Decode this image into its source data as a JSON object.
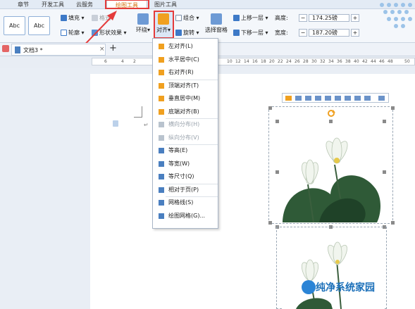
{
  "tabs": [
    "章节",
    "开发工具",
    "云服务",
    "绘图工具",
    "图片工具"
  ],
  "ribbon": {
    "style_samples": [
      "Abc",
      "Abc"
    ],
    "fill": "填充",
    "effect": "格式",
    "outline": "轮廓",
    "shape_effect": "形状效果",
    "wrap": "环绕",
    "align": "对齐",
    "group": "组合",
    "rotate": "旋转",
    "selection_pane": "选择窗格",
    "bring_forward": "上移一层",
    "send_backward": "下移一层",
    "height_label": "高度:",
    "height_value": "174.25磅",
    "width_label": "宽度:",
    "width_value": "187.20磅",
    "minus": "−",
    "plus": "+"
  },
  "doc": {
    "tab_label": "文档3 *",
    "new_tab": "+",
    "close": "×"
  },
  "ruler": {
    "left_ticks": [
      "6",
      "4",
      "2"
    ],
    "right_ticks": [
      "10",
      "12",
      "14",
      "16",
      "18",
      "20",
      "22",
      "24",
      "26",
      "28",
      "30",
      "32",
      "34",
      "36",
      "38",
      "40",
      "42",
      "44",
      "46",
      "48"
    ],
    "end_tick": "50"
  },
  "menu": {
    "items": [
      {
        "label": "左对齐(L)",
        "disabled": false,
        "color": "#f0a020"
      },
      {
        "label": "水平居中(C)",
        "disabled": false,
        "color": "#f0a020"
      },
      {
        "label": "右对齐(R)",
        "disabled": false,
        "color": "#f0a020"
      },
      {
        "label": "顶端对齐(T)",
        "disabled": false,
        "color": "#f0a020"
      },
      {
        "label": "垂直居中(M)",
        "disabled": false,
        "color": "#f0a020"
      },
      {
        "label": "底端对齐(B)",
        "disabled": false,
        "color": "#f0a020"
      },
      {
        "label": "横向分布(H)",
        "disabled": true,
        "color": "#b9c3ce"
      },
      {
        "label": "纵向分布(V)",
        "disabled": true,
        "color": "#b9c3ce"
      },
      {
        "label": "等高(E)",
        "disabled": false,
        "color": "#4a7fc0"
      },
      {
        "label": "等宽(W)",
        "disabled": false,
        "color": "#4a7fc0"
      },
      {
        "label": "等尺寸(Q)",
        "disabled": false,
        "color": "#4a7fc0"
      },
      {
        "label": "相对于页(P)",
        "disabled": false,
        "color": "#4a7fc0"
      },
      {
        "label": "网格线(S)",
        "disabled": false,
        "color": "#4a7fc0"
      },
      {
        "label": "绘图网格(G)...",
        "disabled": false,
        "color": "#4a7fc0"
      }
    ]
  },
  "watermark": "纯净系统家园",
  "colors": {
    "accent": "#e43b3b",
    "active_tab_text": "#d46b08",
    "leaf": "#2f5a37",
    "petal": "#f1f5ee"
  }
}
